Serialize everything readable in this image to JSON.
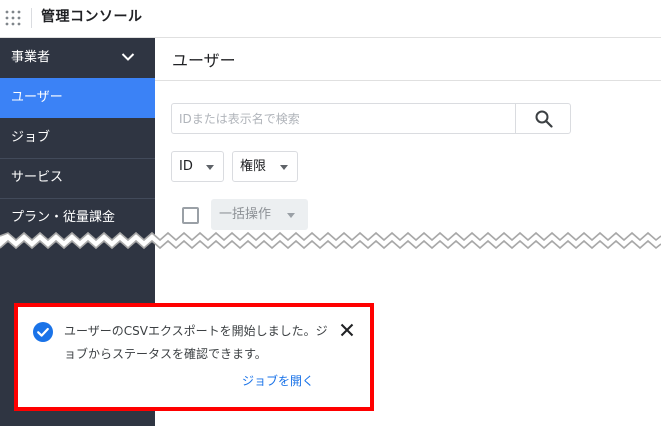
{
  "header": {
    "title": "管理コンソール",
    "apps_icon": "grid-dots-icon"
  },
  "sidebar": {
    "org_label": "事業者",
    "items": [
      {
        "label": "ユーザー",
        "active": true
      },
      {
        "label": "ジョブ",
        "active": false
      },
      {
        "label": "サービス",
        "active": false
      },
      {
        "label": "プラン・従量課金",
        "active": false
      }
    ]
  },
  "main": {
    "title": "ユーザー",
    "search": {
      "placeholder": "IDまたは表示名で検索",
      "value": ""
    },
    "filters": {
      "id_label": "ID",
      "permission_label": "権限"
    },
    "bulk_action_label": "一括操作"
  },
  "toast": {
    "message": "ユーザーのCSVエクスポートを開始しました。ジョブからステータスを確認できます。",
    "action_label": "ジョブを開く"
  },
  "colors": {
    "sidebar_bg": "#2f3542",
    "sidebar_active": "#3b82f6",
    "accent": "#1a73e8",
    "highlight_border": "#ff0000"
  }
}
